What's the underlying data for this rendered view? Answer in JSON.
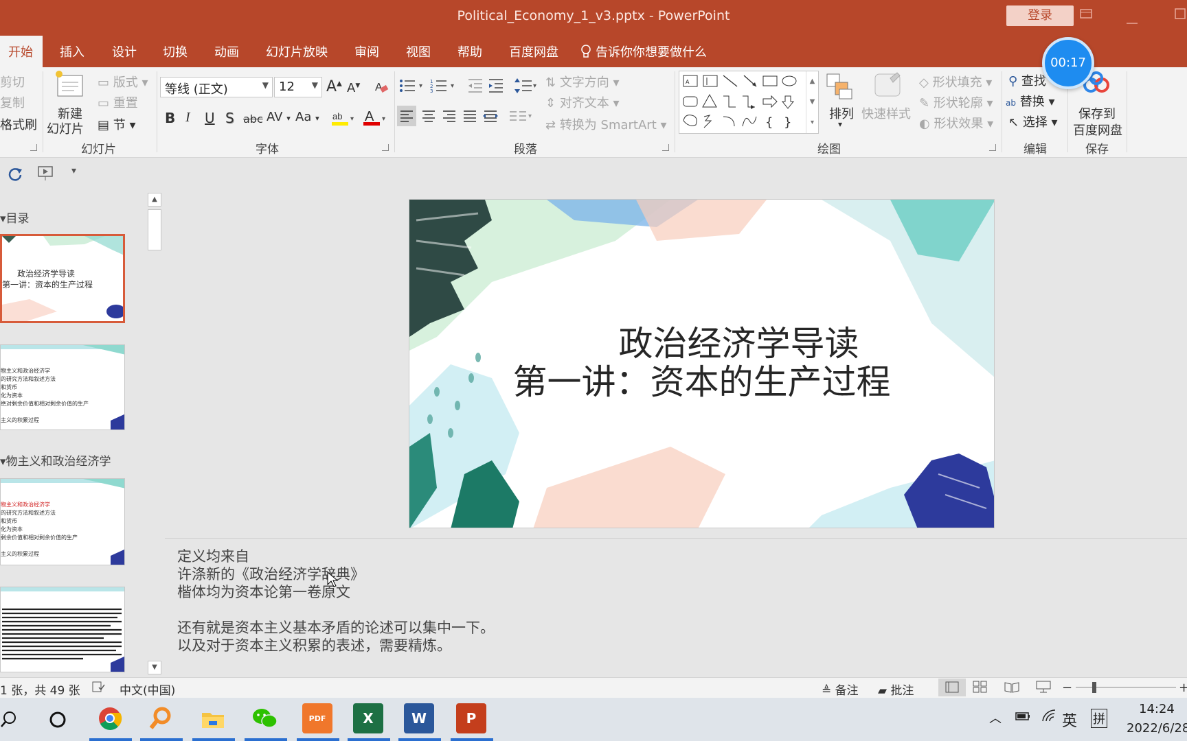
{
  "window": {
    "title": "Political_Economy_1_v3.pptx  -  PowerPoint",
    "login_label": "登录",
    "timer": "00:17"
  },
  "tabs": [
    {
      "label": "开始"
    },
    {
      "label": "插入"
    },
    {
      "label": "设计"
    },
    {
      "label": "切换"
    },
    {
      "label": "动画"
    },
    {
      "label": "幻灯片放映"
    },
    {
      "label": "审阅"
    },
    {
      "label": "视图"
    },
    {
      "label": "帮助"
    },
    {
      "label": "百度网盘"
    }
  ],
  "tell_me": "告诉你你想要做什么",
  "ribbon": {
    "clipboard": {
      "cut": "剪切",
      "copy": "复制",
      "format_painter": "格式刷"
    },
    "slides": {
      "new_slide_1": "新建",
      "new_slide_2": "幻灯片",
      "layout": "版式",
      "reset": "重置",
      "section": "节",
      "group": "幻灯片"
    },
    "font": {
      "name": "等线 (正文)",
      "size": "12",
      "group": "字体",
      "bold": "B",
      "italic": "I",
      "underline": "U",
      "shadow": "S",
      "strike": "abc",
      "spacing": "AV",
      "case": "Aa",
      "grow": "A",
      "shrink": "A"
    },
    "paragraph": {
      "text_direction": "文字方向",
      "align_text": "对齐文本",
      "smartart": "转换为 SmartArt",
      "group": "段落"
    },
    "drawing": {
      "arrange": "排列",
      "quick_styles": "快速样式",
      "shape_fill": "形状填充",
      "shape_outline": "形状轮廓",
      "shape_effects": "形状效果",
      "group": "绘图"
    },
    "editing": {
      "find": "查找",
      "replace": "替换",
      "select": "选择",
      "group": "编辑"
    },
    "save": {
      "line1": "保存到",
      "line2": "百度网盘",
      "group": "保存"
    }
  },
  "thumbnails": {
    "section1": "目录",
    "section2": "物主义和政治经济学",
    "slide1": {
      "line1": "政治经济学导读",
      "line2": "第一讲：资本的生产过程"
    },
    "slide2": [
      "物主义和政治经济学",
      "的研究方法和叙述方法",
      "和货币",
      "化为资本",
      "绝对剩余价值和相对剩余价值的生产",
      "",
      "主义的积累过程"
    ],
    "slide3": [
      "物主义和政治经济学",
      "的研究方法和叙述方法",
      "和货币",
      "化为资本",
      "剩余价值和相对剩余价值的生产",
      "",
      "主义的积累过程"
    ]
  },
  "slide": {
    "title_line1": "政治经济学导读",
    "title_line2": "第一讲：资本的生产过程"
  },
  "notes": [
    "定义均来自",
    "许涤新的《政治经济学辞典》",
    "楷体均为资本论第一卷原文",
    "",
    "还有就是资本主义基本矛盾的论述可以集中一下。",
    "以及对于资本主义积累的表述，需要精炼。"
  ],
  "status": {
    "slide_count": "1 张，共 49 张",
    "language": "中文(中国)",
    "notes_btn": "备注",
    "comments_btn": "批注"
  },
  "taskbar": {
    "ime1": "英",
    "ime2": "拼",
    "time": "14:24",
    "date": "2022/6/28",
    "pdf_label": "PDF"
  },
  "colors": {
    "accent": "#b7472a",
    "ribbon_bg": "#f3f3f3",
    "timer_blue": "#1e8cf0"
  }
}
